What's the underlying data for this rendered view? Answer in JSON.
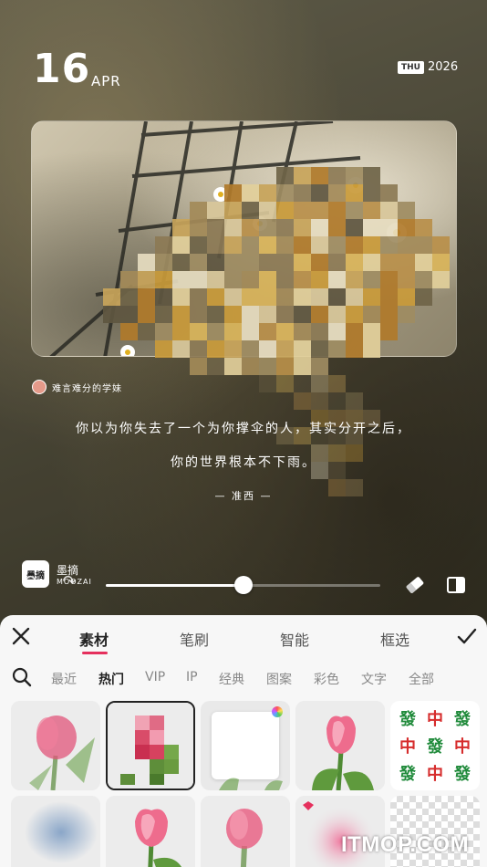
{
  "canvas": {
    "day": "16",
    "month": "APR",
    "weekday": "THU",
    "year": "2026",
    "author": "难言难分的学妹",
    "quote_line1": "你以为你失去了一个为你撑伞的人，其实分开之后，",
    "quote_line2": "你的世界根本不下雨。",
    "quote_sign": "— 准西 —",
    "watermark_cn": "墨摘",
    "watermark_en": "MOOZAI",
    "watermark_logo": "墨摘",
    "brush_size_percent": 50
  },
  "panel": {
    "tabs": [
      "素材",
      "笔刷",
      "智能",
      "框选"
    ],
    "active_tab": 0,
    "categories": [
      "最近",
      "热门",
      "VIP",
      "IP",
      "经典",
      "图案",
      "彩色",
      "文字",
      "全部"
    ],
    "active_category": 1,
    "accent_color": "#e5305d",
    "tiles": [
      {
        "name": "tulip-blur",
        "selected": false
      },
      {
        "name": "pixel-tulip",
        "selected": true
      },
      {
        "name": "blank-white",
        "selected": false
      },
      {
        "name": "tulip",
        "selected": false
      },
      {
        "name": "mahjong-fa-zhong",
        "selected": false
      },
      {
        "name": "blue-blur",
        "selected": false
      },
      {
        "name": "tulip-2",
        "selected": false
      },
      {
        "name": "tulip-blur-2",
        "selected": false
      },
      {
        "name": "pink-scatter",
        "selected": false
      },
      {
        "name": "transparent",
        "selected": false
      }
    ],
    "mahjong_chars": [
      "發",
      "中",
      "發",
      "中",
      "發",
      "中",
      "發",
      "中",
      "發"
    ]
  },
  "site_watermark": "ITMOP.COM"
}
